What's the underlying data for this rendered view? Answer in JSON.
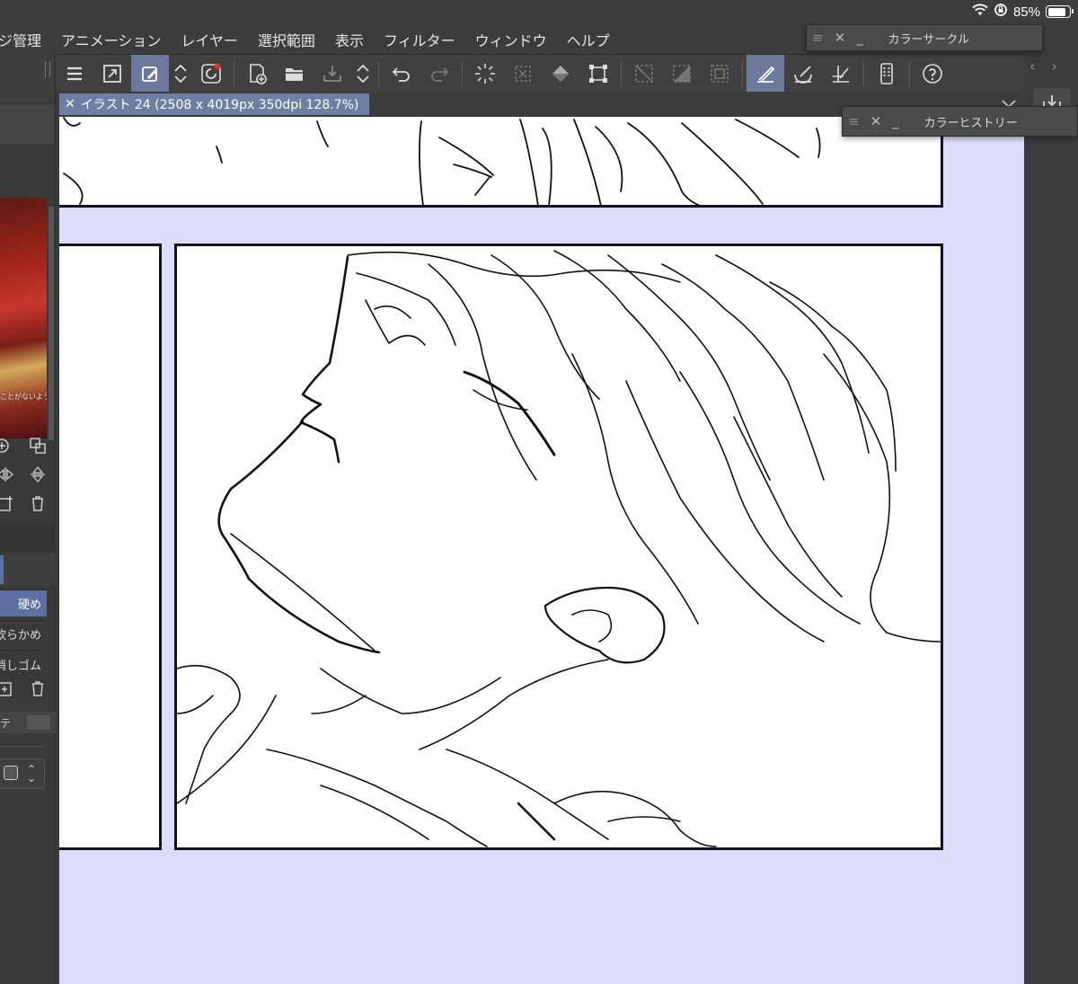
{
  "status_bar": {
    "battery_text": "85%",
    "battery_level": 0.85,
    "icons": [
      "wifi-icon",
      "rotation-lock-icon",
      "battery-icon"
    ]
  },
  "menu": {
    "items": [
      "ジ管理",
      "アニメーション",
      "レイヤー",
      "選択範囲",
      "表示",
      "フィルター",
      "ウィンドウ",
      "ヘルプ"
    ]
  },
  "toolbar": {
    "icons": [
      "menu-icon",
      "fullscreen-icon",
      "edit-shortcut-icon",
      "up-down-icon",
      "clip-studio-icon",
      "new-file-icon",
      "open-file-icon",
      "save-icon",
      "up-down-icon",
      "undo-icon",
      "redo-icon",
      "loading-icon",
      "clear-selection-icon",
      "fill-icon",
      "transform-icon",
      "hide-selection-icon",
      "invert-selection-icon",
      "show-selection-icon",
      "snap-ruler-icon",
      "snap-special-ruler-icon",
      "snap-grid-icon",
      "smartphone-icon",
      "help-icon"
    ]
  },
  "document_tab": {
    "title": "イラスト 24 (2508 x 4019px 350dpi 128.7%)"
  },
  "left_panel": {
    "thumbnail_caption": "ことがないよう",
    "brush_items": [
      "硬め",
      "軟らかめ",
      "消しゴム"
    ],
    "tab_label": "テ"
  },
  "palettes": {
    "color_circle": "カラーサークル",
    "color_history": "カラーヒストリー"
  },
  "colors": {
    "canvas_bg": "#dcdcfb",
    "ui_bg": "#3c3c3c",
    "active_tool": "#6b7a9a",
    "tab_bg": "#6d7fa3",
    "panel_border": "#11111f"
  }
}
